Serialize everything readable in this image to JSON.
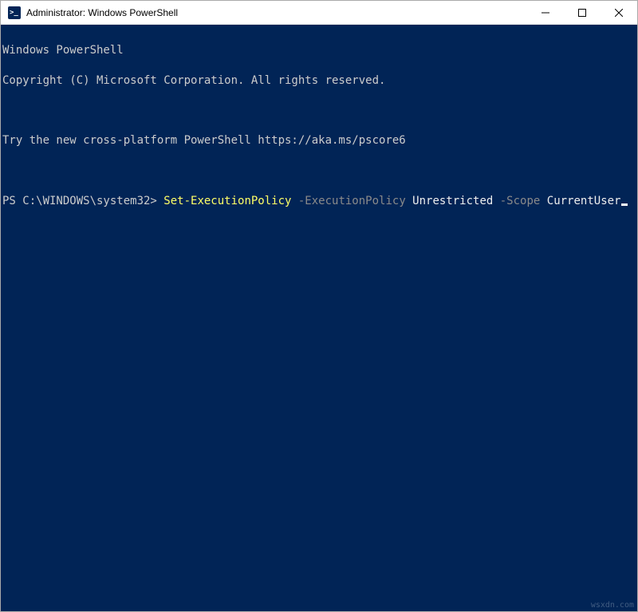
{
  "window": {
    "title": "Administrator: Windows PowerShell"
  },
  "terminal": {
    "banner_line1": "Windows PowerShell",
    "banner_line2": "Copyright (C) Microsoft Corporation. All rights reserved.",
    "try_line": "Try the new cross-platform PowerShell https://aka.ms/pscore6",
    "prompt": "PS C:\\WINDOWS\\system32> ",
    "command": {
      "cmdlet": "Set-ExecutionPolicy",
      "param1_flag": " -ExecutionPolicy ",
      "param1_value": "Unrestricted",
      "param2_flag": " -Scope ",
      "param2_value": "CurrentUser"
    }
  },
  "watermark": "wsxdn.com",
  "colors": {
    "terminal_bg": "#012456",
    "text": "#cccccc",
    "cmdlet": "#ffff66",
    "param_flag": "#8a8a8a",
    "param_value": "#eeeeee"
  }
}
